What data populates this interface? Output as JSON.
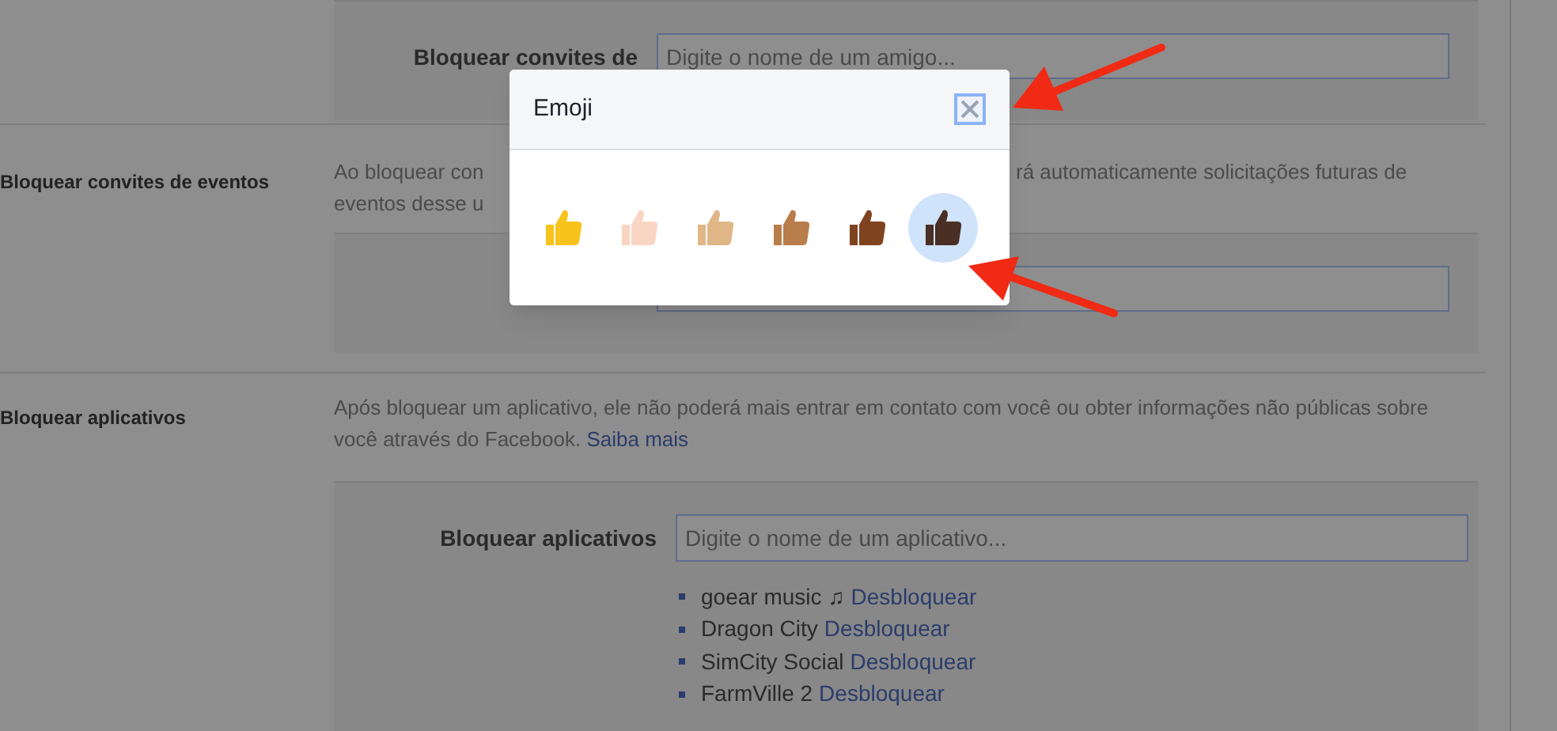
{
  "top_box": {
    "label": "Bloquear convites de",
    "placeholder": "Digite o nome de um amigo..."
  },
  "events": {
    "label": "Bloquear convites de eventos",
    "lines": [
      {
        "left": "Ao bloquear con",
        "right": "rá automaticamente solicitações futuras de"
      },
      {
        "left": "eventos desse u"
      }
    ]
  },
  "apps": {
    "label": "Bloquear aplicativos",
    "description": "Após bloquear um aplicativo, ele não poderá mais entrar em contato com você ou obter informações não públicas sobre você através do Facebook.",
    "link": "Saiba mais",
    "field_label": "Bloquear aplicativos",
    "placeholder": "Digite o nome de um aplicativo...",
    "blocked": [
      {
        "name": "goear music",
        "icon": "♫",
        "action": "Desbloquear"
      },
      {
        "name": "Dragon City",
        "action": "Desbloquear"
      },
      {
        "name": "SimCity Social",
        "action": "Desbloquear"
      },
      {
        "name": "FarmVille 2",
        "action": "Desbloquear"
      }
    ]
  },
  "dialog": {
    "title": "Emoji",
    "emojis": [
      {
        "color": "#f7c31c",
        "selected": false
      },
      {
        "color": "#f9d6c4",
        "selected": false
      },
      {
        "color": "#e1b687",
        "selected": false
      },
      {
        "color": "#b97d4c",
        "selected": false
      },
      {
        "color": "#7f4320",
        "selected": false
      },
      {
        "color": "#4a3024",
        "selected": true
      }
    ]
  }
}
